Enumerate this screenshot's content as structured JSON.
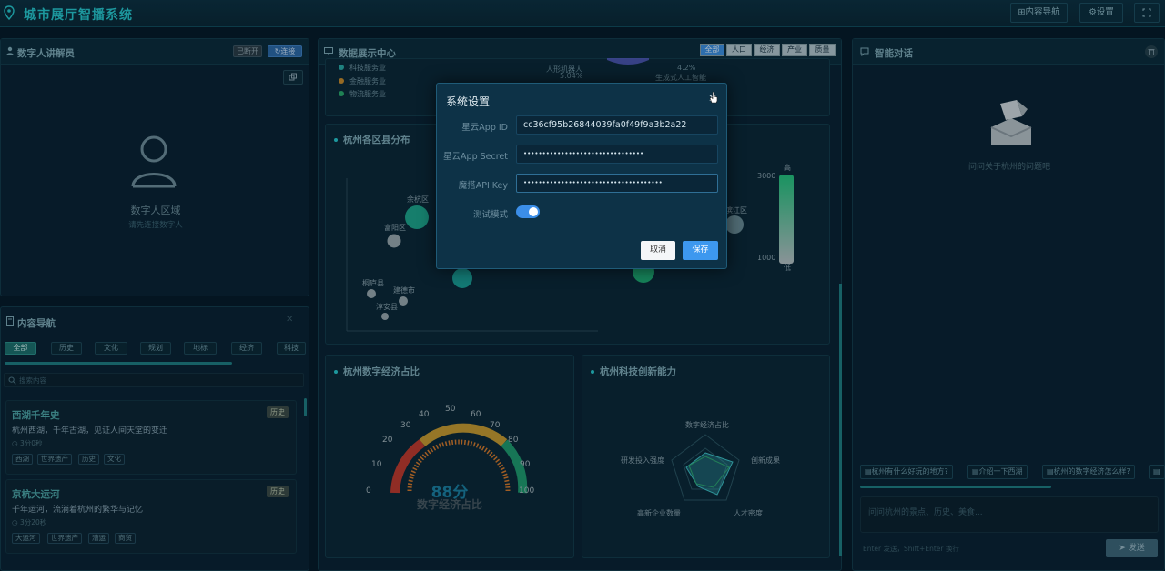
{
  "app": {
    "title": "城市展厅智播系统",
    "nav_button": "⊞内容导航",
    "settings_button": "⚙设置",
    "fullscreen_icon": "fullscreen-icon"
  },
  "digital_human": {
    "title": "数字人讲解员",
    "status": "已断开",
    "connect_button": "↻连接",
    "area_label": "数字人区域",
    "area_hint": "请先连接数字人"
  },
  "content_nav": {
    "title": "内容导航",
    "filters": [
      "全部",
      "历史",
      "文化",
      "规划",
      "地标",
      "经济",
      "科技"
    ],
    "search_placeholder": "搜索内容",
    "cards": [
      {
        "title": "西湖千年史",
        "badge": "历史",
        "desc": "杭州西湖，千年古湖，见证人间天堂的变迁",
        "time": "3分0秒",
        "tags": [
          "西湖",
          "世界遗产",
          "历史",
          "文化"
        ]
      },
      {
        "title": "京杭大运河",
        "badge": "历史",
        "desc": "千年运河，流淌着杭州的繁华与记忆",
        "time": "3分20秒",
        "tags": [
          "大运河",
          "世界遗产",
          "漕运",
          "商贸"
        ]
      }
    ]
  },
  "data_center": {
    "title": "数据展示中心",
    "segments": [
      "全部",
      "人口",
      "经济",
      "产业",
      "质量"
    ],
    "legend_items": [
      "科技服务业",
      "金融服务业",
      "物流服务业"
    ],
    "pie_labels": [
      "人形机器人",
      "5.04%",
      "4.2%",
      "生成式人工智能"
    ],
    "district_chart": {
      "title": "杭州各区县分布",
      "labels": [
        "余杭区",
        "富阳区",
        "桐庐县",
        "建德市",
        "淳安县",
        "滨江区"
      ],
      "scale_high": "高",
      "scale_low": "低",
      "scale_max": "3000",
      "scale_min": "1000"
    },
    "gauge": {
      "title": "杭州数字经济占比",
      "value_text": "88分",
      "caption": "数字经济占比",
      "ticks": [
        "0",
        "10",
        "20",
        "30",
        "40",
        "50",
        "60",
        "70",
        "80",
        "90",
        "100"
      ]
    },
    "radar": {
      "title": "杭州科技创新能力",
      "axes": [
        "数字经济占比",
        "创新成果",
        "人才密度",
        "高新企业数量",
        "研发投入强度"
      ]
    }
  },
  "chat": {
    "title": "智能对话",
    "empty_text": "问问关于杭州的问题吧",
    "suggestions": [
      "▤杭州有什么好玩的地方?",
      "▤介绍一下西湖",
      "▤杭州的数字经济怎么样?",
      "▤"
    ],
    "input_placeholder": "问问杭州的景点、历史、美食...",
    "hint": "Enter 发送，Shift+Enter 换行",
    "send_button": "发送"
  },
  "settings_modal": {
    "title": "系统设置",
    "fields": [
      {
        "label": "星云App ID",
        "value": "cc36cf95b26844039fa0f49f9a3b2a22"
      },
      {
        "label": "星云App Secret",
        "value": "••••••••••••••••••••••••••••••••"
      },
      {
        "label": "魔搭API Key",
        "value": "•••••••••••••••••••••••••••••••••••••"
      }
    ],
    "test_mode_label": "测试模式",
    "test_mode_on": true,
    "cancel": "取消",
    "save": "保存"
  }
}
